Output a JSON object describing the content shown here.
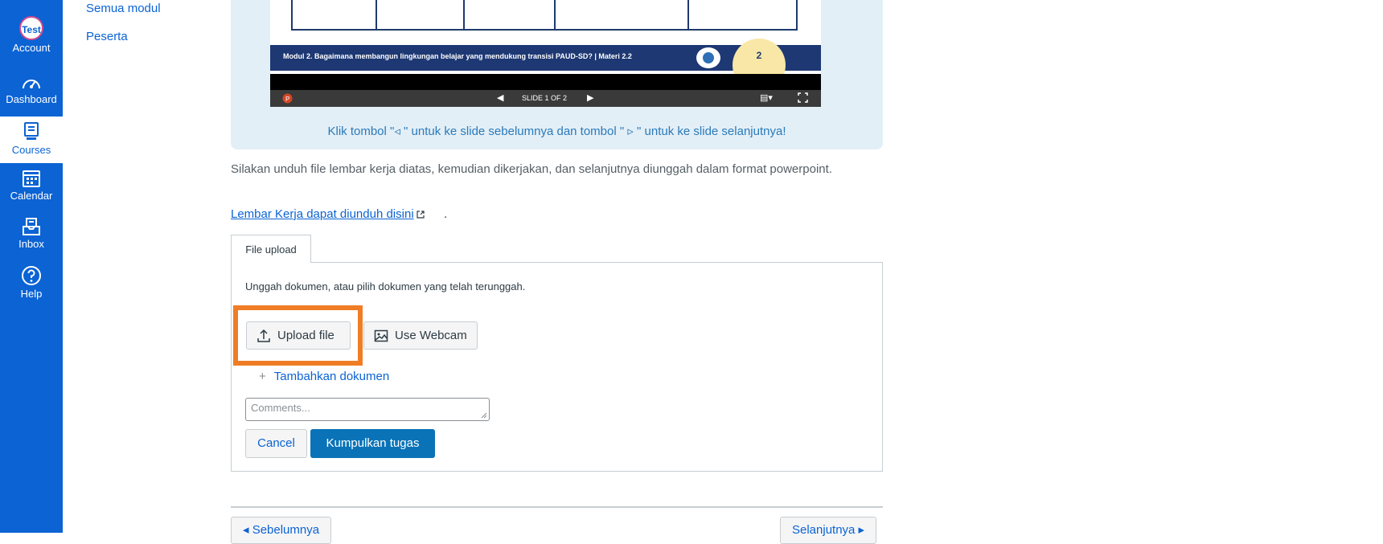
{
  "global_nav": {
    "account": {
      "avatar_text": "Test",
      "label": "Account"
    },
    "dashboard": {
      "label": "Dashboard"
    },
    "courses": {
      "label": "Courses"
    },
    "calendar": {
      "label": "Calendar"
    },
    "inbox": {
      "label": "Inbox"
    },
    "help": {
      "label": "Help"
    }
  },
  "course_nav": {
    "items": [
      {
        "label": "Semua modul"
      },
      {
        "label": "Peserta"
      }
    ]
  },
  "slide": {
    "banner_text": "Modul 2. Bagaimana membangun lingkungan belajar yang mendukung transisi PAUD-SD? | Materi 2.2",
    "page_badge": "2",
    "counter": "SLIDE 1 OF 2",
    "hint": "Klik tombol  \"◃ \" untuk ke slide sebelumnya dan tombol \" ▹ \" untuk ke slide selanjutnya!"
  },
  "content": {
    "instruction": "Silakan unduh file lembar kerja diatas, kemudian dikerjakan, dan selanjutnya diunggah dalam format powerpoint.",
    "worksheet_link": "Lembar Kerja dapat diunduh disini",
    "worksheet_suffix": "."
  },
  "upload": {
    "tab_label": "File upload",
    "instruction": "Unggah dokumen, atau pilih dokumen yang telah terunggah.",
    "upload_button": "Upload file",
    "webcam_button": "Use Webcam",
    "add_document": "Tambahkan dokumen",
    "comments_placeholder": "Comments...",
    "cancel_button": "Cancel",
    "submit_button": "Kumpulkan tugas"
  },
  "pager": {
    "previous": "◂ Sebelumnya",
    "next": "Selanjutnya ▸"
  },
  "colors": {
    "nav_bg": "#0b63d4",
    "highlight": "#f07d26",
    "primary_button": "#0a73b8",
    "slide_panel": "#e3eff7"
  },
  "icons": [
    "account-avatar",
    "dashboard-icon",
    "courses-icon",
    "calendar-icon",
    "inbox-icon",
    "help-icon",
    "external-link-icon",
    "upload-icon",
    "image-icon",
    "plus-icon"
  ]
}
